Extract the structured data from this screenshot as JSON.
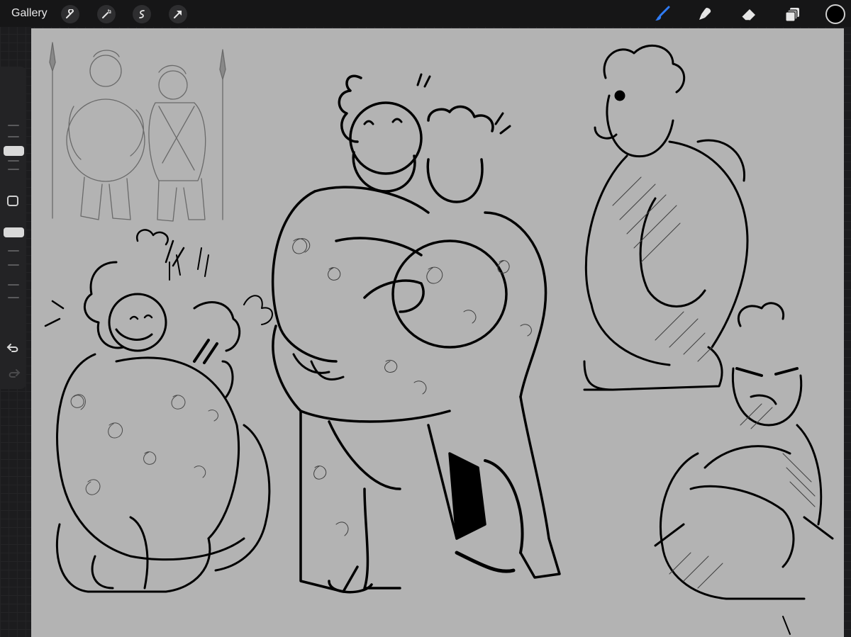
{
  "toolbar": {
    "gallery_label": "Gallery",
    "left_tools": [
      "wrench-icon",
      "magic-wand-icon",
      "selection-icon",
      "transform-arrow-icon"
    ],
    "right_tools": [
      "brush-icon",
      "smudge-icon",
      "eraser-icon",
      "layers-icon"
    ],
    "active_tool": "brush-icon",
    "active_color": "#000000",
    "accent": "#2f7cf6"
  },
  "sidebar": {
    "brush_size_level": 0.45,
    "opacity_level": 0.9
  },
  "canvas": {
    "background": "#b3b3b3"
  }
}
